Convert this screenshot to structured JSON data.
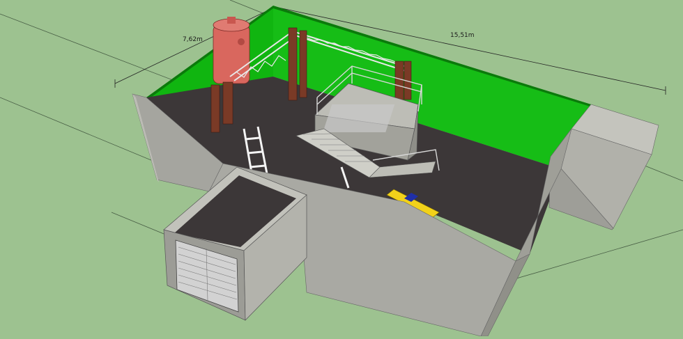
{
  "dimensions": {
    "width_label": "7,62m",
    "length_label": "15,51m"
  },
  "colors": {
    "ground": "#9dc290",
    "green_wall": "#12b812",
    "concrete": "#a8a8a2",
    "concrete_dark": "#8d8d87",
    "concrete_light": "#c4c4bd",
    "soil": "#3c3738",
    "steel_column": "#7a3a26",
    "tank": "#d9675e",
    "pipe_yellow": "#f2d21a",
    "pipe_blue": "#1f2fa8",
    "grating": "#c9c9c9"
  }
}
